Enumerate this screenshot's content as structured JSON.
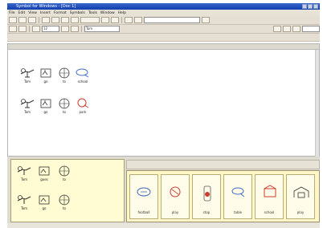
{
  "window": {
    "title": "Symbol for Windows - [Doc 1]"
  },
  "menu": [
    "File",
    "Edit",
    "View",
    "Insert",
    "Format",
    "Symbols",
    "Tools",
    "Window",
    "Help"
  ],
  "toolbar": {
    "font_size": "12",
    "symbol_field": "Tom"
  },
  "document": {
    "row1": [
      "Tom",
      "go",
      "to",
      "school"
    ],
    "row2": [
      "Tom",
      "go",
      "to",
      "park"
    ]
  },
  "grid_panel": {
    "row1": [
      "Tom",
      "goes",
      "to"
    ],
    "row2": [
      "Tom",
      "go",
      "to"
    ]
  },
  "cards": [
    "football",
    "play",
    "stop",
    "table",
    "school",
    "play"
  ],
  "colors": {
    "accent": "#1d4fb8",
    "panel": "#fff9cc",
    "red_symbol": "#cc3b30",
    "blue_symbol": "#3f6bc1"
  }
}
